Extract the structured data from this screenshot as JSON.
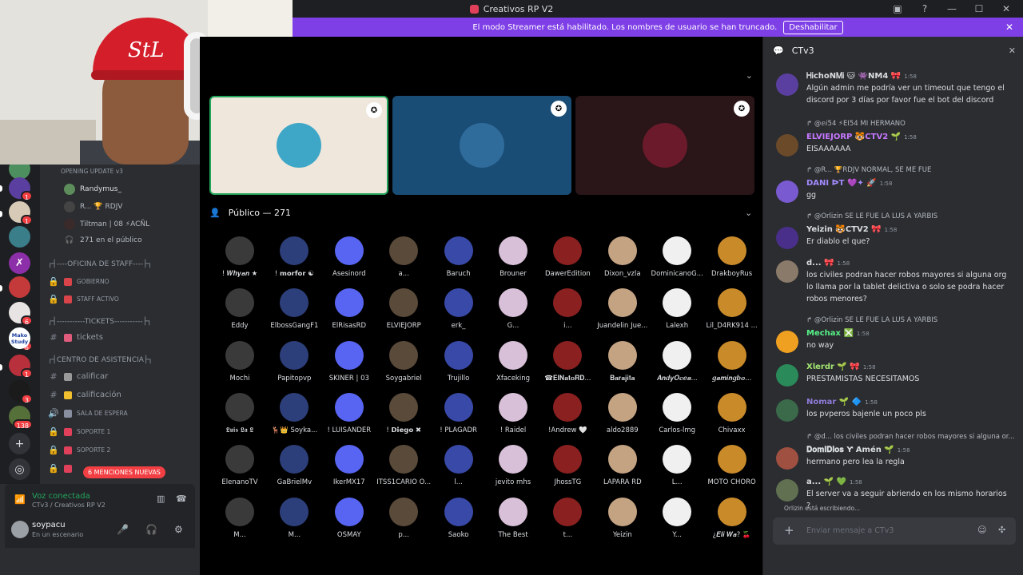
{
  "window": {
    "title": "Creativos RP V2",
    "controls": [
      "▣",
      "?",
      "—",
      "☐",
      "✕"
    ]
  },
  "banner": {
    "text": "El modo Streamer está habilitado. Los nombres de usuario se han truncado.",
    "button": "Deshabilitar"
  },
  "webcam": {
    "hat_logo": "StL"
  },
  "servers": [
    {
      "badge": ""
    },
    {
      "badge": "1"
    },
    {
      "badge": "1"
    },
    {
      "badge": ""
    },
    {
      "badge": ""
    },
    {
      "badge": ""
    },
    {
      "badge": "6"
    },
    {
      "badge": "6"
    },
    {
      "badge": ""
    },
    {
      "badge": "1"
    },
    {
      "badge": "3"
    },
    {
      "badge": "138"
    }
  ],
  "server_mini_text": {
    "mako": "Mako Study"
  },
  "voice_users": {
    "opening": "OPENING UPDATE v3",
    "u1": "Randymus_",
    "u2": "R... 🏆 RDJV",
    "u3": "Tiltman | 08 ⚡ACÑL",
    "audience": "271 en el público"
  },
  "categories": {
    "staff": "┌┤----OFICINA DE STAFF----├┐",
    "tickets": "┌┤-----------TICKETS-----------├┐",
    "assist": "┌┤CENTRO DE ASISTENCIA├┐"
  },
  "channels": {
    "gobierno": "GOBIERNO",
    "staff_activo": "STAFF ACTIVO",
    "tickets": "tickets",
    "calificar": "calificar",
    "calificacion": "calificación",
    "sala_espera": "SALA DE ESPERA",
    "soporte1": "SOPORTE 1",
    "soporte2": "SOPORTE 2"
  },
  "mentions_badge": "6 MENCIONES NUEVAS",
  "voice_status": {
    "connected": "Voz conectada",
    "location": "CTv3 / Creativos RP V2"
  },
  "user": {
    "name": "soypacu",
    "status": "En un escenario"
  },
  "audience_header": "Público — 271",
  "audience": [
    "! 𝑾𝒉𝒚𝒂𝒏 ★",
    "! 𝗺𝗼𝗿𝗳𝗼𝗿 ☯",
    "Asesinord",
    "a...",
    "Baruch",
    "Brouner",
    "DawerEdition",
    "Dixon_vzla",
    "DominicanoG...",
    "DrakboyRus",
    "Eddy",
    "ElbossGangF1",
    "ElRisasRD",
    "ELVIEJORP",
    "erk_",
    "G...",
    "i...",
    "Juandelin Jue...",
    "Lalexh",
    "Lil_D4RK914 ...",
    "Mochi",
    "Papitopvp",
    "SKINER | 03",
    "Soygabriel",
    "Trujillo",
    "Xfaceking",
    "☎𝐄𝐥𝐍𝐚𝐭𝐨𝐑𝐃...",
    "𝐁𝐚𝐫𝐚𝐣𝐢𝐭𝐚",
    "𝑨𝒏𝒅𝒚𝑶𝒄𝒆𝒂...",
    "𝒈𝒂𝒎𝒊𝒏𝒈𝒃𝒐...",
    "𝕷𝖚𝖎𝖘 𝕷𝖆 𝕷",
    "🦌👑 Soyka...",
    "! LUISANDER",
    "! 𝗗𝗶𝗲𝗴𝗼 ✖",
    "! PLAGADR",
    "! Raidel",
    "!Andrew 🤍",
    "aldo2889",
    "Carlos-lmg",
    "Chivaxx",
    "ElenanoTV",
    "GaBrielMv",
    "IkerMX17",
    "ITSS1CARIO O...",
    "l...",
    "jevito mhs",
    "JhossTG",
    "LAPARA RD",
    "L...",
    "MOTO CHORO",
    "M...",
    "M...",
    "OSMAY",
    "p...",
    "Saoko",
    "The Best",
    "t...",
    "Yeizin",
    "Y...",
    "¿𝑬𝒍𝒊 𝑾𝒂? 🍒"
  ],
  "chat": {
    "channel": "CTv3",
    "messages": [
      {
        "reply": "",
        "name": "ᎻᎥchoNᎷᎥ 🐱 👾NM4 🎀",
        "time": "1:58",
        "color": "#dbdee1",
        "text": "Algún admin me podría ver un timeout que tengo el discord por 3 días por favor fue el bot del discord"
      },
      {
        "reply": "↱ @ⅇⅈ54 ⚡EI54  MI HERMANO",
        "name": "ELVIEJORP 🐯CTV2 🌱",
        "time": "1:58",
        "color": "#c678ff",
        "text": "EISAAAAAA"
      },
      {
        "reply": "↱ @R... 🏆RDJV  NORMAL, SE ME FUE",
        "name": "DANI ᐅT 💜✦ 🚀",
        "time": "1:58",
        "color": "#a48bff",
        "text": "gg"
      },
      {
        "reply": "↱ @Orlizin  SE LE FUE LA LUS A YARBIS",
        "name": "Yeizin 🐯CTV2 🎀",
        "time": "1:58",
        "color": "#dbdee1",
        "text": "Er diablo el que?"
      },
      {
        "reply": "",
        "name": "d... 🎀",
        "time": "1:58",
        "color": "#dbdee1",
        "text": "los civiles podran hacer robos mayores si alguna org lo llama por la tablet delictiva o solo se podra hacer robos menores?"
      },
      {
        "reply": "↱ @Orlizin  SE LE FUE LA LUS A YARBIS",
        "name": "𝗠𝗲𝗰𝗵𝗮𝘅 ❎",
        "time": "1:58",
        "color": "#57f287",
        "text": "no way"
      },
      {
        "reply": "",
        "name": "𝗫𝗹𝗲𝗿𝗱𝗿 🌱 🎀",
        "time": "1:58",
        "color": "#a3e66f",
        "text": "PRESTAMISTAS NECESITAMOS"
      },
      {
        "reply": "",
        "name": "Nomar 🌱 🔷",
        "time": "1:58",
        "color": "#8f7bd8",
        "text": "los pvperos bajenle un poco pls"
      },
      {
        "reply": "↱ @d... los civiles podran hacer robos mayores si alguna or...",
        "name": "𝐃𝐨𝐦𝐢𝐃𝐢𝐨𝐬 Ƴ Amén 🌱",
        "time": "1:58",
        "color": "#dbdee1",
        "text": "hermano pero lea la regla"
      },
      {
        "reply": "",
        "name": "a... 🌱 💚",
        "time": "1:58",
        "color": "#dbdee1",
        "text": "El server va a seguir abriendo en los mismo horarios ?"
      }
    ],
    "typing": "Orlizin está escribiendo...",
    "placeholder": "Enviar mensaje a CTv3"
  },
  "colors": {
    "banner": "#7e3fe6",
    "mentions": "#f23f43",
    "voice": "#23a55a",
    "sidebar": "#2b2d31"
  }
}
